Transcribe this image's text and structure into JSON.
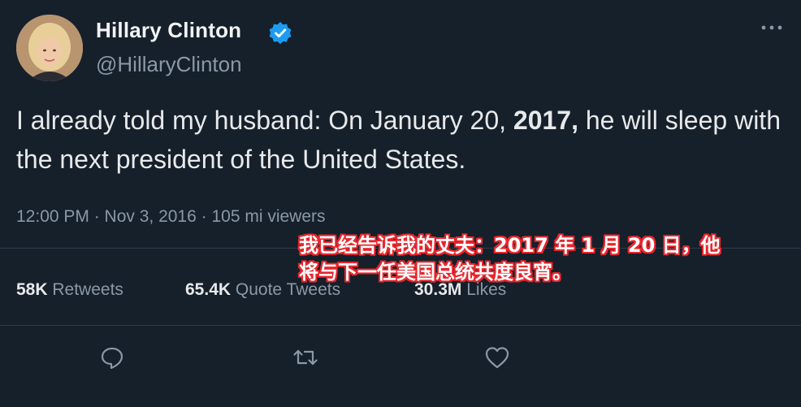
{
  "author": {
    "display_name": "Hillary Clinton",
    "handle": "@HillaryClinton",
    "verified_color": "#1d9bf0"
  },
  "tweet": {
    "text_before": "I already told my husband: On January 20, ",
    "text_bold": "2017,",
    "text_after": " he will sleep with the next president of the United States.",
    "meta": "12:00 PM · Nov 3, 2016 · 105 mi viewers"
  },
  "stats": {
    "retweets": {
      "count": "58K",
      "label": "Retweets"
    },
    "quote_tweets": {
      "count": "65.4K",
      "label": "Quote Tweets"
    },
    "likes": {
      "count": "30.3M",
      "label": "Likes"
    }
  },
  "overlay_caption": "我已经告诉我的丈夫：2017 年 1 月 20 日，他将与下一任美国总统共度良宵。",
  "icons": {
    "more": "more-horizontal-icon",
    "reply": "reply-icon",
    "retweet": "retweet-icon",
    "like": "heart-icon"
  },
  "colors": {
    "background": "#15202b",
    "muted": "#8b98a5",
    "caption_outline": "#e8262c"
  }
}
